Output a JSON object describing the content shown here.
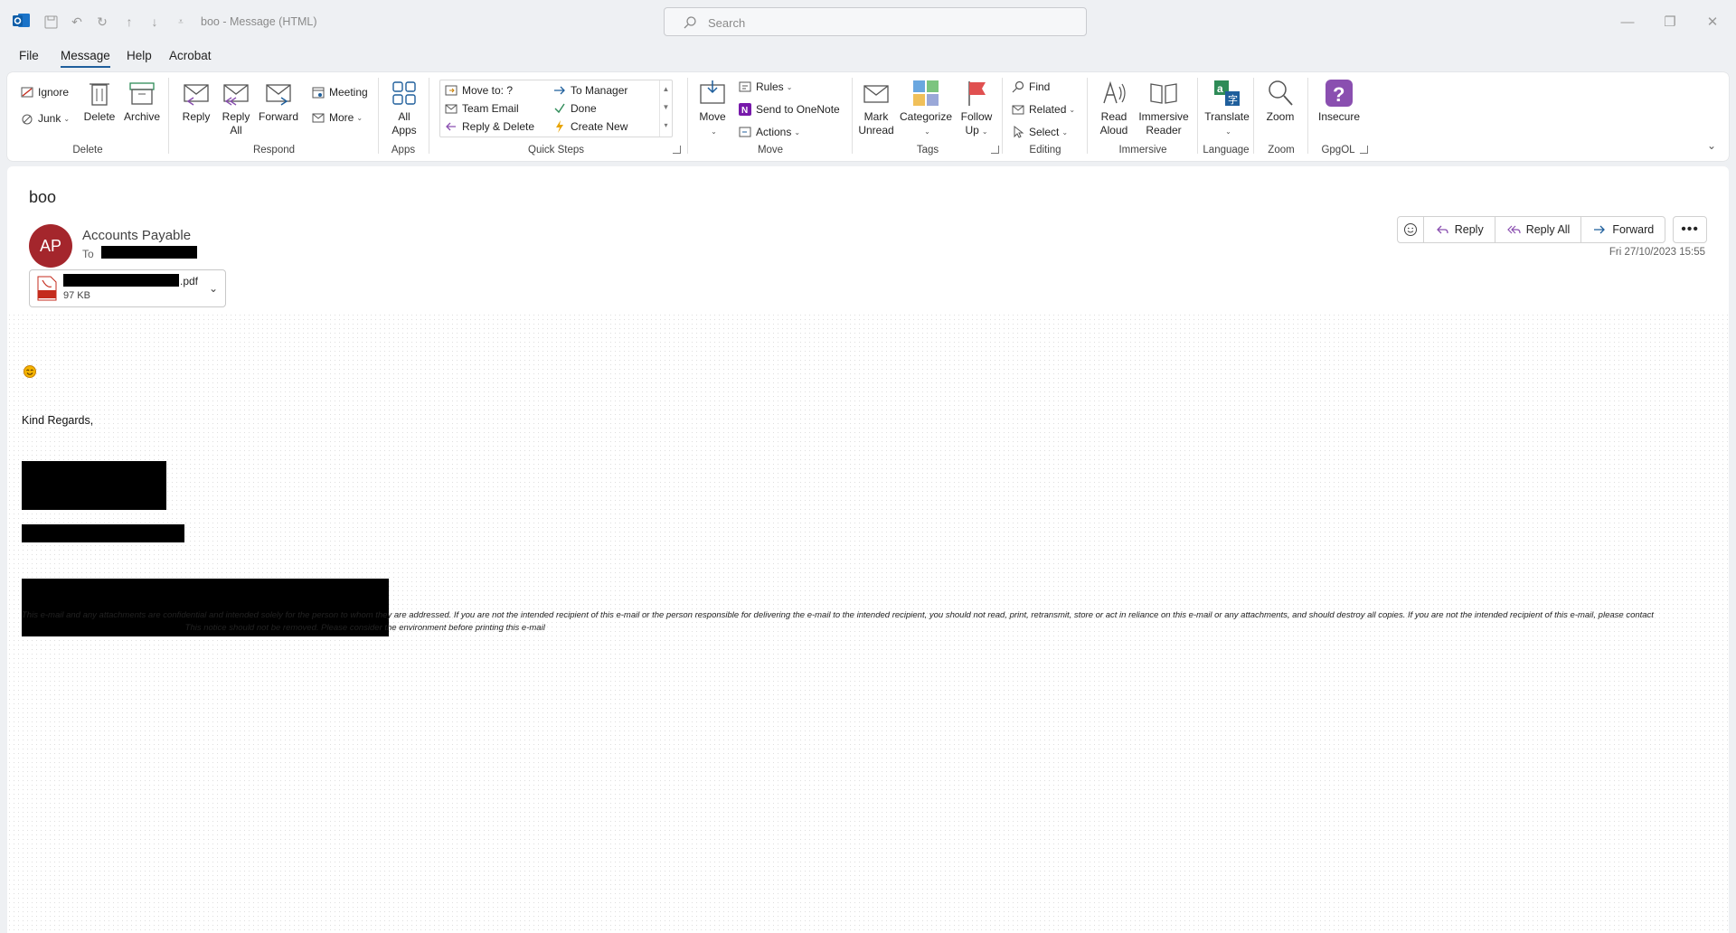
{
  "window": {
    "title": "boo  -  Message (HTML)",
    "search_placeholder": "Search"
  },
  "menu": [
    "File",
    "Message",
    "Help",
    "Acrobat"
  ],
  "ribbon": {
    "delete_group": {
      "label": "Delete",
      "ignore": "Ignore",
      "junk": "Junk",
      "delete": "Delete",
      "archive": "Archive"
    },
    "respond_group": {
      "label": "Respond",
      "reply": "Reply",
      "reply_all_1": "Reply",
      "reply_all_2": "All",
      "forward": "Forward",
      "meeting": "Meeting",
      "more": "More"
    },
    "apps_group": {
      "label": "Apps",
      "all_apps_1": "All",
      "all_apps_2": "Apps"
    },
    "quick_steps": {
      "label": "Quick Steps",
      "items": [
        "Move to: ?",
        "To Manager",
        "Team Email",
        "Done",
        "Reply & Delete",
        "Create New"
      ]
    },
    "move_group": {
      "label": "Move",
      "move": "Move",
      "rules": "Rules",
      "onenote": "Send to OneNote",
      "actions": "Actions"
    },
    "tags_group": {
      "label": "Tags",
      "mark_unread_1": "Mark",
      "mark_unread_2": "Unread",
      "categorize": "Categorize",
      "follow_up_1": "Follow",
      "follow_up_2": "Up"
    },
    "editing_group": {
      "label": "Editing",
      "find": "Find",
      "related": "Related",
      "select": "Select"
    },
    "immersive_group": {
      "label": "Immersive",
      "read_aloud_1": "Read",
      "read_aloud_2": "Aloud",
      "immersive_reader_1": "Immersive",
      "immersive_reader_2": "Reader"
    },
    "language_group": {
      "label": "Language",
      "translate": "Translate"
    },
    "zoom_group": {
      "label": "Zoom",
      "zoom": "Zoom"
    },
    "gpgol_group": {
      "label": "GpgOL",
      "insecure": "Insecure"
    }
  },
  "message": {
    "subject": "boo",
    "avatar_initials": "AP",
    "sender": "Accounts Payable",
    "to_label": "To",
    "date": "Fri 27/10/2023 15:55",
    "actions": {
      "reply": "Reply",
      "reply_all": "Reply All",
      "forward": "Forward"
    },
    "attachment": {
      "extension": ".pdf",
      "size": "97 KB"
    },
    "body": {
      "regards": "Kind Regards,",
      "disclaimer_part1": "This e-mail and any attachments are confidential and intended solely for the person to whom they are addressed.  If you are not the intended recipient of this e-mail or the person responsible for delivering the e-mail to the intended recipient, you should not read, print, retransmit, store or act in reliance on this e-mail or any attachments, and should destroy all copies.  If you are not the intended recipient of this e-mail, please contact",
      "disclaimer_part2": "  This notice should not be removed.  Please consider the environment before printing this e-mail"
    }
  },
  "colors": {
    "avatar": "#a4262c",
    "accent": "#1f5f9c",
    "gpgol": "#8a4fb0"
  }
}
